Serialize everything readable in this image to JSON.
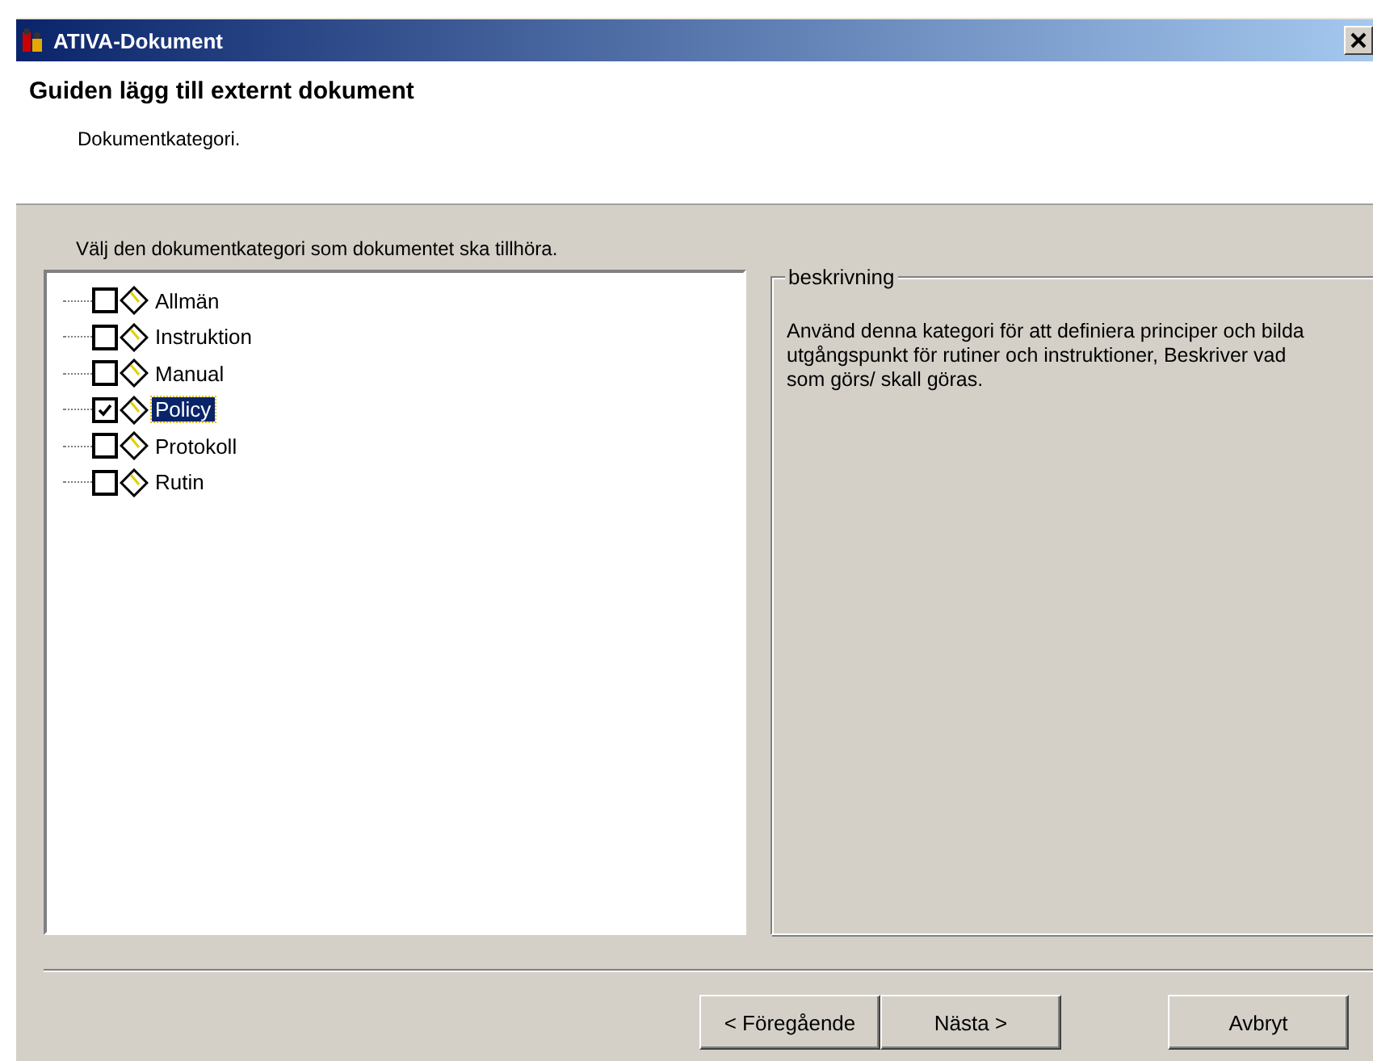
{
  "window": {
    "title": "ATIVA-Dokument"
  },
  "header": {
    "title": "Guiden lägg till externt dokument",
    "subtitle": "Dokumentkategori."
  },
  "instruction": "Välj den dokumentkategori som dokumentet ska tillhöra.",
  "tree": {
    "items": [
      {
        "label": "Allmän",
        "checked": false,
        "selected": false
      },
      {
        "label": "Instruktion",
        "checked": false,
        "selected": false
      },
      {
        "label": "Manual",
        "checked": false,
        "selected": false
      },
      {
        "label": "Policy",
        "checked": true,
        "selected": true
      },
      {
        "label": "Protokoll",
        "checked": false,
        "selected": false
      },
      {
        "label": "Rutin",
        "checked": false,
        "selected": false
      }
    ]
  },
  "description": {
    "legend": "beskrivning",
    "text": "Använd denna kategori för att definiera principer och bilda utgångspunkt för rutiner och instruktioner, Beskriver vad som görs/ skall göras."
  },
  "buttons": [
    {
      "label": "< Föregående",
      "kind": "back"
    },
    {
      "label": "Nästa >",
      "kind": "next"
    },
    {
      "label": "Avbryt",
      "kind": "cancel"
    }
  ]
}
